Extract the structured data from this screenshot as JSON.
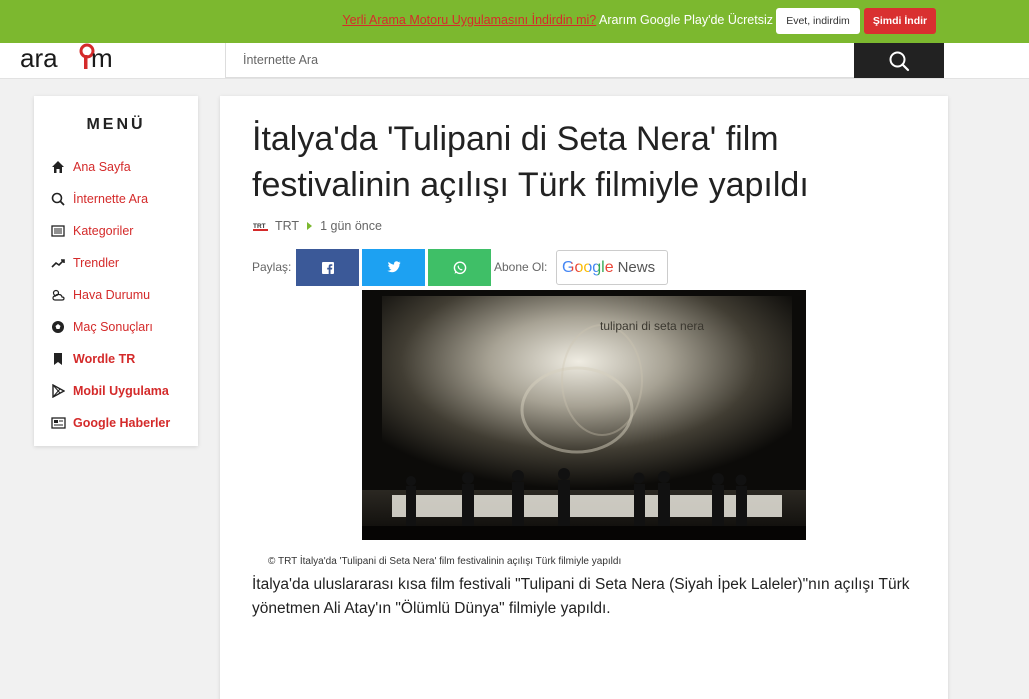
{
  "banner": {
    "promo_link": "Yerli Arama Motoru Uygulamasını İndirdin mi?",
    "promo_text": "Ararım Google Play'de Ücretsiz",
    "yes_button": "Evet, indirdim",
    "download_button": "Şimdi İndir"
  },
  "header": {
    "logo_text": "ararım",
    "search_placeholder": "İnternette Ara"
  },
  "sidebar": {
    "title": "MENÜ",
    "items": [
      {
        "label": "Ana Sayfa",
        "icon": "home-icon"
      },
      {
        "label": "İnternette Ara",
        "icon": "search-icon"
      },
      {
        "label": "Kategoriler",
        "icon": "list-icon"
      },
      {
        "label": "Trendler",
        "icon": "trending-icon"
      },
      {
        "label": "Hava Durumu",
        "icon": "weather-icon"
      },
      {
        "label": "Maç Sonuçları",
        "icon": "soccer-ball-icon"
      },
      {
        "label": "Wordle TR",
        "icon": "bookmark-icon"
      },
      {
        "label": "Mobil Uygulama",
        "icon": "play-store-icon"
      },
      {
        "label": "Google Haberler",
        "icon": "newspaper-icon"
      }
    ]
  },
  "article": {
    "title": "İtalya'da 'Tulipani di Seta Nera' film festivalinin açılışı Türk filmiyle yapıldı",
    "source": "TRT",
    "time": "1 gün önce",
    "share_label": "Paylaş:",
    "subscribe_label": "Abone Ol:",
    "google_news": {
      "google": "Google",
      "news": "News"
    },
    "caption": "© TRT İtalya'da 'Tulipani di Seta Nera' film festivalinin açılışı Türk filmiyle yapıldı",
    "photo_screen_text": "tulipani di seta nera",
    "body": "İtalya'da uluslararası kısa film festivali \"Tulipani di Seta Nera (Siyah İpek Laleler)\"nın açılışı Türk yönetmen Ali Atay'ın \"Ölümlü Dünya\" filmiyle yapıldı."
  },
  "colors": {
    "banner_green": "#7cb82f",
    "accent_red": "#d42a2a",
    "facebook": "#3b5998",
    "twitter": "#1da1f2",
    "whatsapp": "#3fbf67"
  }
}
